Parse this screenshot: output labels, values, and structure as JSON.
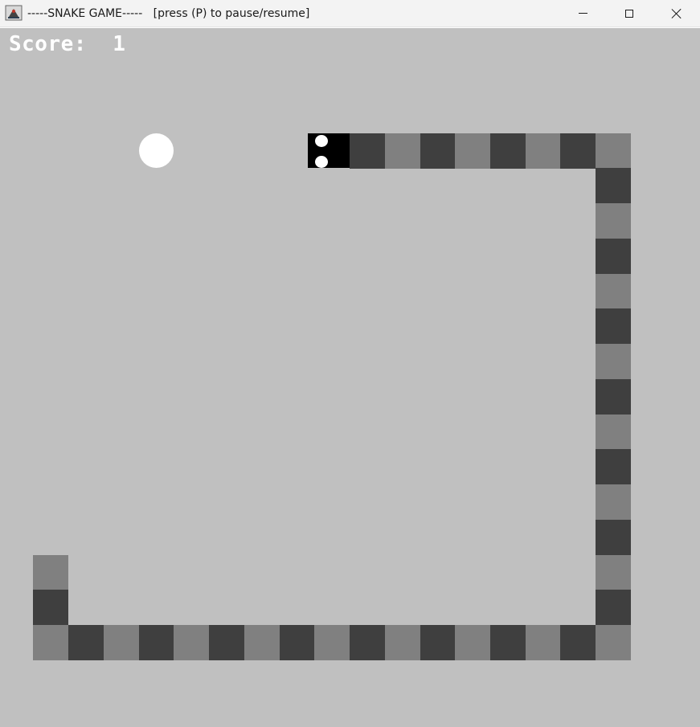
{
  "window": {
    "title": "-----SNAKE GAME-----   [press (P) to pause/resume]",
    "icon": "java-app-icon"
  },
  "controls": {
    "minimize": "minimize-icon",
    "maximize": "maximize-icon",
    "close": "close-icon"
  },
  "game": {
    "score_text": "Score:  1",
    "colors": {
      "background": "#c0c0c0",
      "segment_dark": "#3f3f3f",
      "segment_light": "#808080",
      "head": "#000000",
      "food": "#ffffff",
      "score_text": "#ffffff"
    }
  }
}
